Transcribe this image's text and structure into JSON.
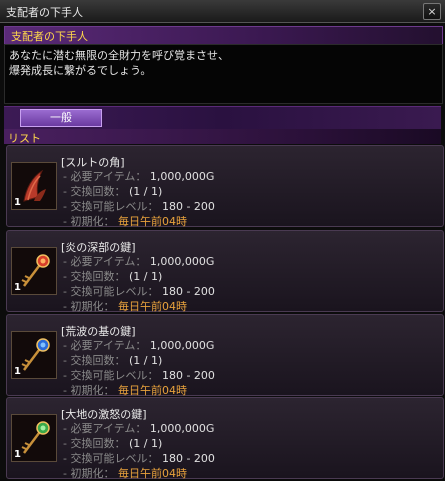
{
  "window": {
    "title": "支配者の下手人",
    "close_label": "×"
  },
  "npc": {
    "name": "支配者の下手人"
  },
  "description": {
    "line1": "あなたに潜む無限の全財力を呼び覚まさせ、",
    "line2": "爆発成長に繋がるでしょう。"
  },
  "tabs": [
    {
      "label": "一般"
    }
  ],
  "list_header": "リスト",
  "items": [
    {
      "name": "[スルトの角]",
      "icon": "horn-icon",
      "quantity": "1",
      "req_label": "- 必要アイテム： ",
      "req_value": "1,000,000G",
      "count_label": "- 交換回数： ",
      "count_value": "(1 / 1)",
      "level_label": "- 交換可能レベル： ",
      "level_value": "180 - 200",
      "reset_label": "- 初期化： ",
      "reset_value": "毎日午前04時"
    },
    {
      "name": "[炎の深部の鍵]",
      "icon": "flame-key-icon",
      "quantity": "1",
      "req_label": "- 必要アイテム： ",
      "req_value": "1,000,000G",
      "count_label": "- 交換回数： ",
      "count_value": "(1 / 1)",
      "level_label": "- 交換可能レベル： ",
      "level_value": "180 - 200",
      "reset_label": "- 初期化： ",
      "reset_value": "毎日午前04時"
    },
    {
      "name": "[荒波の基の鍵]",
      "icon": "wave-key-icon",
      "quantity": "1",
      "req_label": "- 必要アイテム： ",
      "req_value": "1,000,000G",
      "count_label": "- 交換回数： ",
      "count_value": "(1 / 1)",
      "level_label": "- 交換可能レベル： ",
      "level_value": "180 - 200",
      "reset_label": "- 初期化： ",
      "reset_value": "毎日午前04時"
    },
    {
      "name": "[大地の激怒の鍵]",
      "icon": "earth-key-icon",
      "quantity": "1",
      "req_label": "- 必要アイテム： ",
      "req_value": "1,000,000G",
      "count_label": "- 交換回数： ",
      "count_value": "(1 / 1)",
      "level_label": "- 交換可能レベル： ",
      "level_value": "180 - 200",
      "reset_label": "- 初期化： ",
      "reset_value": "毎日午前04時"
    }
  ],
  "colors": {
    "accent_gold": "#ffd84a",
    "time_orange": "#e8a23c",
    "purple": "#5a2a78"
  }
}
